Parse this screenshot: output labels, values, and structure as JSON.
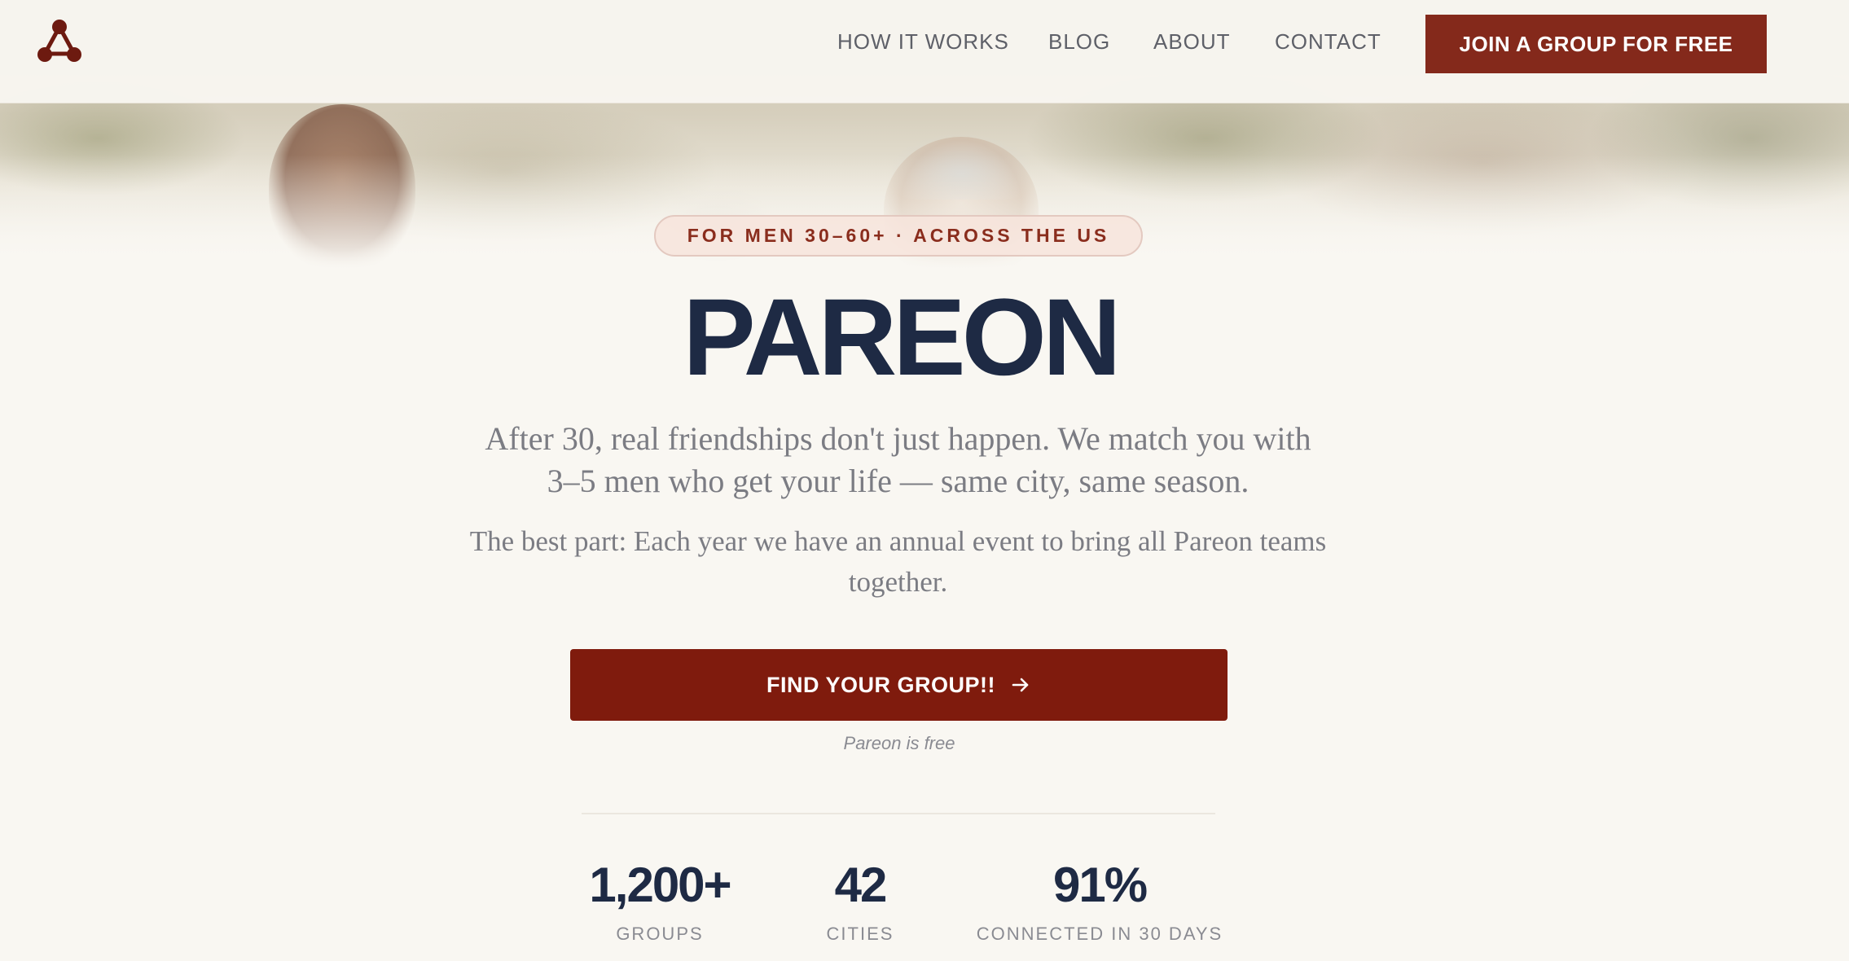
{
  "nav": {
    "logo_name": "triangle-nodes-logo",
    "links": [
      {
        "label": "HOW IT WORKS"
      },
      {
        "label": "BLOG"
      },
      {
        "label": "ABOUT"
      },
      {
        "label": "CONTACT"
      }
    ],
    "cta_label": "JOIN A GROUP FOR FREE"
  },
  "hero": {
    "badge": "FOR MEN 30–60+ · ACROSS THE US",
    "title": "PAREON",
    "lead": "After 30, real friendships don't just happen. We match you with 3–5 men who get your life — same city, same season.",
    "sub": "The best part: Each year we have an annual event to bring all Pareon teams together.",
    "cta_label": "FIND YOUR GROUP!!",
    "cta_icon": "arrow-right-icon",
    "note": "Pareon is free"
  },
  "stats": [
    {
      "value": "1,200+",
      "label": "GROUPS"
    },
    {
      "value": "42",
      "label": "CITIES"
    },
    {
      "value": "91%",
      "label": "CONNECTED IN 30 DAYS"
    }
  ],
  "colors": {
    "brand": "#84291b",
    "cta": "#7f1b0d",
    "heading": "#1e2a44",
    "muted": "#7b7c83",
    "background": "#f9f7f2"
  }
}
